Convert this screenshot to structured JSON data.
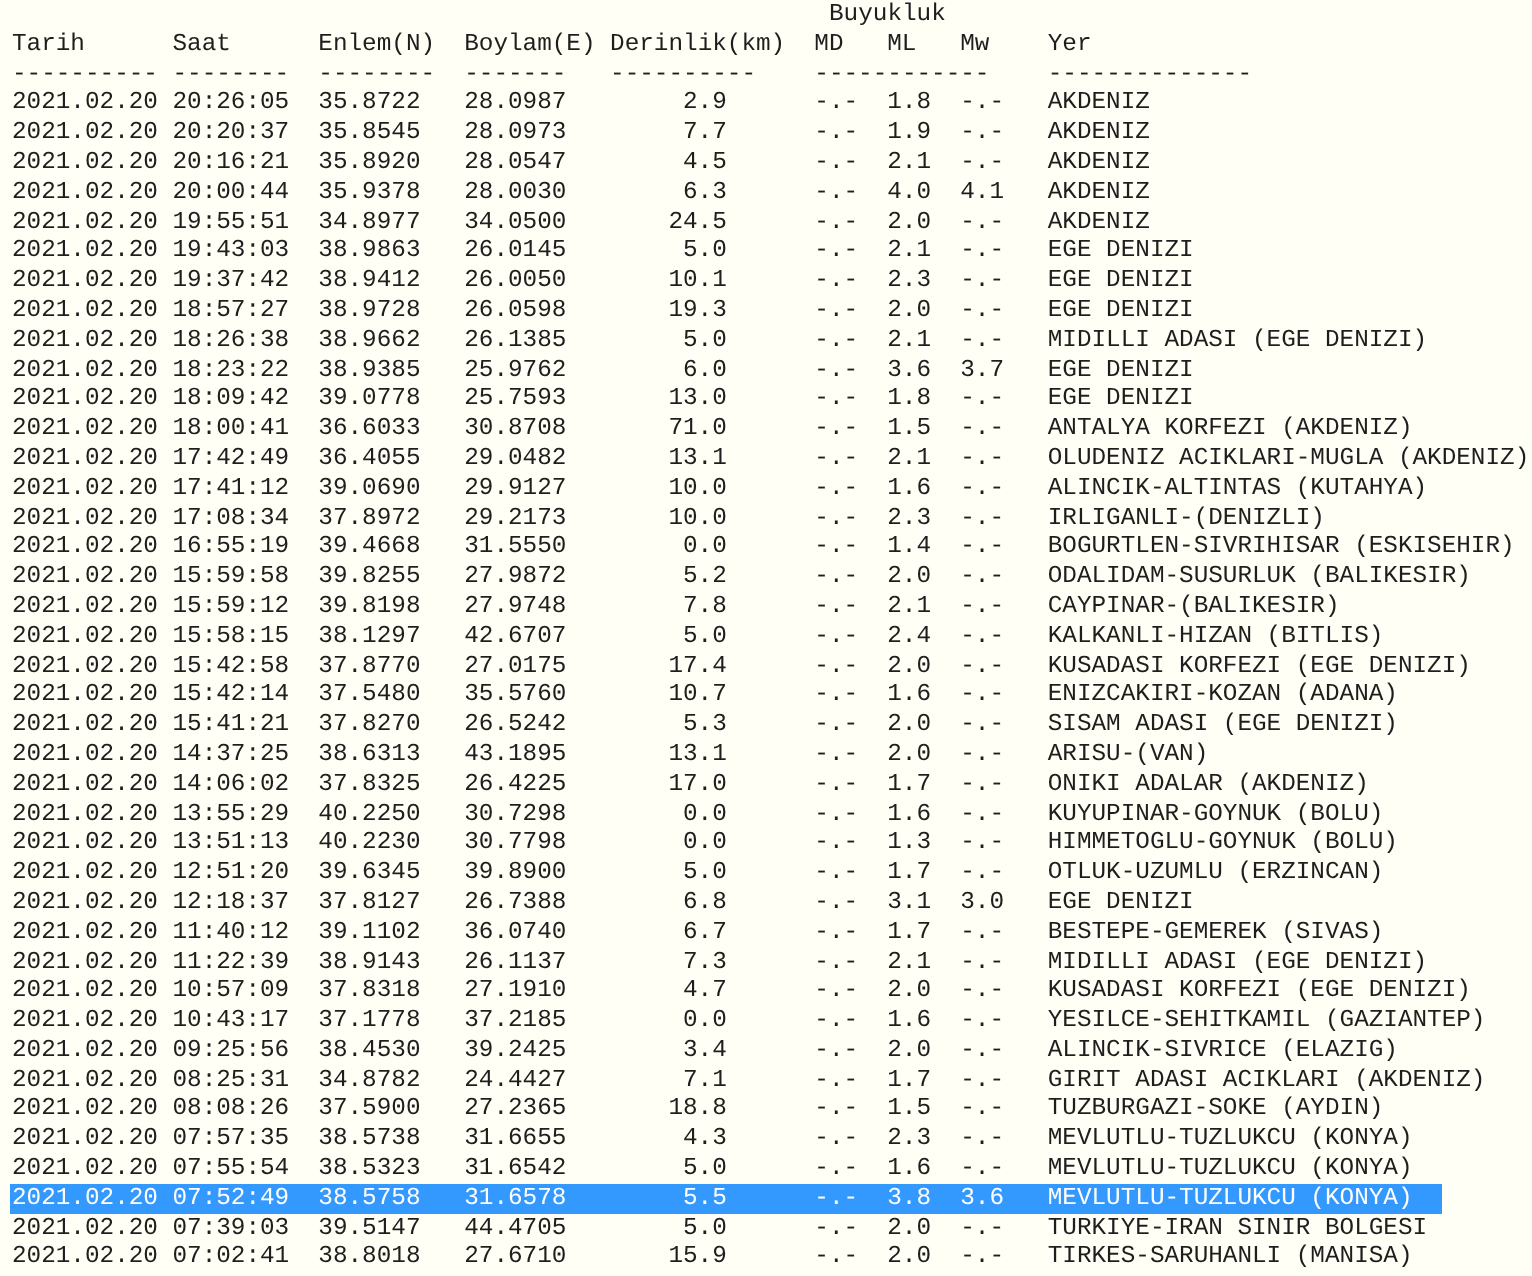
{
  "group_header": "Buyukluk",
  "columns": [
    "Tarih",
    "Saat",
    "Enlem(N)",
    "Boylam(E)",
    "Derinlik(km)",
    "MD",
    "ML",
    "Mw",
    "Yer"
  ],
  "separators": [
    "----------",
    "--------",
    "--------",
    "-------",
    "----------",
    "------------",
    "--------------"
  ],
  "rows": [
    {
      "date": "2021.02.20",
      "time": "20:26:05",
      "lat": "35.8722",
      "lon": "28.0987",
      "depth": "2.9",
      "md": "-.-",
      "ml": "1.8",
      "mw": "-.-",
      "place": "AKDENIZ",
      "selected": false
    },
    {
      "date": "2021.02.20",
      "time": "20:20:37",
      "lat": "35.8545",
      "lon": "28.0973",
      "depth": "7.7",
      "md": "-.-",
      "ml": "1.9",
      "mw": "-.-",
      "place": "AKDENIZ",
      "selected": false
    },
    {
      "date": "2021.02.20",
      "time": "20:16:21",
      "lat": "35.8920",
      "lon": "28.0547",
      "depth": "4.5",
      "md": "-.-",
      "ml": "2.1",
      "mw": "-.-",
      "place": "AKDENIZ",
      "selected": false
    },
    {
      "date": "2021.02.20",
      "time": "20:00:44",
      "lat": "35.9378",
      "lon": "28.0030",
      "depth": "6.3",
      "md": "-.-",
      "ml": "4.0",
      "mw": "4.1",
      "place": "AKDENIZ",
      "selected": false
    },
    {
      "date": "2021.02.20",
      "time": "19:55:51",
      "lat": "34.8977",
      "lon": "34.0500",
      "depth": "24.5",
      "md": "-.-",
      "ml": "2.0",
      "mw": "-.-",
      "place": "AKDENIZ",
      "selected": false
    },
    {
      "date": "2021.02.20",
      "time": "19:43:03",
      "lat": "38.9863",
      "lon": "26.0145",
      "depth": "5.0",
      "md": "-.-",
      "ml": "2.1",
      "mw": "-.-",
      "place": "EGE DENIZI",
      "selected": false
    },
    {
      "date": "2021.02.20",
      "time": "19:37:42",
      "lat": "38.9412",
      "lon": "26.0050",
      "depth": "10.1",
      "md": "-.-",
      "ml": "2.3",
      "mw": "-.-",
      "place": "EGE DENIZI",
      "selected": false
    },
    {
      "date": "2021.02.20",
      "time": "18:57:27",
      "lat": "38.9728",
      "lon": "26.0598",
      "depth": "19.3",
      "md": "-.-",
      "ml": "2.0",
      "mw": "-.-",
      "place": "EGE DENIZI",
      "selected": false
    },
    {
      "date": "2021.02.20",
      "time": "18:26:38",
      "lat": "38.9662",
      "lon": "26.1385",
      "depth": "5.0",
      "md": "-.-",
      "ml": "2.1",
      "mw": "-.-",
      "place": "MIDILLI ADASI (EGE DENIZI)",
      "selected": false
    },
    {
      "date": "2021.02.20",
      "time": "18:23:22",
      "lat": "38.9385",
      "lon": "25.9762",
      "depth": "6.0",
      "md": "-.-",
      "ml": "3.6",
      "mw": "3.7",
      "place": "EGE DENIZI",
      "selected": false
    },
    {
      "date": "2021.02.20",
      "time": "18:09:42",
      "lat": "39.0778",
      "lon": "25.7593",
      "depth": "13.0",
      "md": "-.-",
      "ml": "1.8",
      "mw": "-.-",
      "place": "EGE DENIZI",
      "selected": false
    },
    {
      "date": "2021.02.20",
      "time": "18:00:41",
      "lat": "36.6033",
      "lon": "30.8708",
      "depth": "71.0",
      "md": "-.-",
      "ml": "1.5",
      "mw": "-.-",
      "place": "ANTALYA KORFEZI (AKDENIZ)",
      "selected": false
    },
    {
      "date": "2021.02.20",
      "time": "17:42:49",
      "lat": "36.4055",
      "lon": "29.0482",
      "depth": "13.1",
      "md": "-.-",
      "ml": "2.1",
      "mw": "-.-",
      "place": "OLUDENIZ ACIKLARI-MUGLA (AKDENIZ)",
      "selected": false
    },
    {
      "date": "2021.02.20",
      "time": "17:41:12",
      "lat": "39.0690",
      "lon": "29.9127",
      "depth": "10.0",
      "md": "-.-",
      "ml": "1.6",
      "mw": "-.-",
      "place": "ALINCIK-ALTINTAS (KUTAHYA)",
      "selected": false
    },
    {
      "date": "2021.02.20",
      "time": "17:08:34",
      "lat": "37.8972",
      "lon": "29.2173",
      "depth": "10.0",
      "md": "-.-",
      "ml": "2.3",
      "mw": "-.-",
      "place": "IRLIGANLI-(DENIZLI)",
      "selected": false
    },
    {
      "date": "2021.02.20",
      "time": "16:55:19",
      "lat": "39.4668",
      "lon": "31.5550",
      "depth": "0.0",
      "md": "-.-",
      "ml": "1.4",
      "mw": "-.-",
      "place": "BOGURTLEN-SIVRIHISAR (ESKISEHIR)",
      "selected": false
    },
    {
      "date": "2021.02.20",
      "time": "15:59:58",
      "lat": "39.8255",
      "lon": "27.9872",
      "depth": "5.2",
      "md": "-.-",
      "ml": "2.0",
      "mw": "-.-",
      "place": "ODALIDAM-SUSURLUK (BALIKESIR)",
      "selected": false
    },
    {
      "date": "2021.02.20",
      "time": "15:59:12",
      "lat": "39.8198",
      "lon": "27.9748",
      "depth": "7.8",
      "md": "-.-",
      "ml": "2.1",
      "mw": "-.-",
      "place": "CAYPINAR-(BALIKESIR)",
      "selected": false
    },
    {
      "date": "2021.02.20",
      "time": "15:58:15",
      "lat": "38.1297",
      "lon": "42.6707",
      "depth": "5.0",
      "md": "-.-",
      "ml": "2.4",
      "mw": "-.-",
      "place": "KALKANLI-HIZAN (BITLIS)",
      "selected": false
    },
    {
      "date": "2021.02.20",
      "time": "15:42:58",
      "lat": "37.8770",
      "lon": "27.0175",
      "depth": "17.4",
      "md": "-.-",
      "ml": "2.0",
      "mw": "-.-",
      "place": "KUSADASI KORFEZI (EGE DENIZI)",
      "selected": false
    },
    {
      "date": "2021.02.20",
      "time": "15:42:14",
      "lat": "37.5480",
      "lon": "35.5760",
      "depth": "10.7",
      "md": "-.-",
      "ml": "1.6",
      "mw": "-.-",
      "place": "ENIZCAKIRI-KOZAN (ADANA)",
      "selected": false
    },
    {
      "date": "2021.02.20",
      "time": "15:41:21",
      "lat": "37.8270",
      "lon": "26.5242",
      "depth": "5.3",
      "md": "-.-",
      "ml": "2.0",
      "mw": "-.-",
      "place": "SISAM ADASI (EGE DENIZI)",
      "selected": false
    },
    {
      "date": "2021.02.20",
      "time": "14:37:25",
      "lat": "38.6313",
      "lon": "43.1895",
      "depth": "13.1",
      "md": "-.-",
      "ml": "2.0",
      "mw": "-.-",
      "place": "ARISU-(VAN)",
      "selected": false
    },
    {
      "date": "2021.02.20",
      "time": "14:06:02",
      "lat": "37.8325",
      "lon": "26.4225",
      "depth": "17.0",
      "md": "-.-",
      "ml": "1.7",
      "mw": "-.-",
      "place": "ONIKI ADALAR (AKDENIZ)",
      "selected": false
    },
    {
      "date": "2021.02.20",
      "time": "13:55:29",
      "lat": "40.2250",
      "lon": "30.7298",
      "depth": "0.0",
      "md": "-.-",
      "ml": "1.6",
      "mw": "-.-",
      "place": "KUYUPINAR-GOYNUK (BOLU)",
      "selected": false
    },
    {
      "date": "2021.02.20",
      "time": "13:51:13",
      "lat": "40.2230",
      "lon": "30.7798",
      "depth": "0.0",
      "md": "-.-",
      "ml": "1.3",
      "mw": "-.-",
      "place": "HIMMETOGLU-GOYNUK (BOLU)",
      "selected": false
    },
    {
      "date": "2021.02.20",
      "time": "12:51:20",
      "lat": "39.6345",
      "lon": "39.8900",
      "depth": "5.0",
      "md": "-.-",
      "ml": "1.7",
      "mw": "-.-",
      "place": "OTLUK-UZUMLU (ERZINCAN)",
      "selected": false
    },
    {
      "date": "2021.02.20",
      "time": "12:18:37",
      "lat": "37.8127",
      "lon": "26.7388",
      "depth": "6.8",
      "md": "-.-",
      "ml": "3.1",
      "mw": "3.0",
      "place": "EGE DENIZI",
      "selected": false
    },
    {
      "date": "2021.02.20",
      "time": "11:40:12",
      "lat": "39.1102",
      "lon": "36.0740",
      "depth": "6.7",
      "md": "-.-",
      "ml": "1.7",
      "mw": "-.-",
      "place": "BESTEPE-GEMEREK (SIVAS)",
      "selected": false
    },
    {
      "date": "2021.02.20",
      "time": "11:22:39",
      "lat": "38.9143",
      "lon": "26.1137",
      "depth": "7.3",
      "md": "-.-",
      "ml": "2.1",
      "mw": "-.-",
      "place": "MIDILLI ADASI (EGE DENIZI)",
      "selected": false
    },
    {
      "date": "2021.02.20",
      "time": "10:57:09",
      "lat": "37.8318",
      "lon": "27.1910",
      "depth": "4.7",
      "md": "-.-",
      "ml": "2.0",
      "mw": "-.-",
      "place": "KUSADASI KORFEZI (EGE DENIZI)",
      "selected": false
    },
    {
      "date": "2021.02.20",
      "time": "10:43:17",
      "lat": "37.1778",
      "lon": "37.2185",
      "depth": "0.0",
      "md": "-.-",
      "ml": "1.6",
      "mw": "-.-",
      "place": "YESILCE-SEHITKAMIL (GAZIANTEP)",
      "selected": false
    },
    {
      "date": "2021.02.20",
      "time": "09:25:56",
      "lat": "38.4530",
      "lon": "39.2425",
      "depth": "3.4",
      "md": "-.-",
      "ml": "2.0",
      "mw": "-.-",
      "place": "ALINCIK-SIVRICE (ELAZIG)",
      "selected": false
    },
    {
      "date": "2021.02.20",
      "time": "08:25:31",
      "lat": "34.8782",
      "lon": "24.4427",
      "depth": "7.1",
      "md": "-.-",
      "ml": "1.7",
      "mw": "-.-",
      "place": "GIRIT ADASI ACIKLARI (AKDENIZ)",
      "selected": false
    },
    {
      "date": "2021.02.20",
      "time": "08:08:26",
      "lat": "37.5900",
      "lon": "27.2365",
      "depth": "18.8",
      "md": "-.-",
      "ml": "1.5",
      "mw": "-.-",
      "place": "TUZBURGAZI-SOKE (AYDIN)",
      "selected": false
    },
    {
      "date": "2021.02.20",
      "time": "07:57:35",
      "lat": "38.5738",
      "lon": "31.6655",
      "depth": "4.3",
      "md": "-.-",
      "ml": "2.3",
      "mw": "-.-",
      "place": "MEVLUTLU-TUZLUKCU (KONYA)",
      "selected": false
    },
    {
      "date": "2021.02.20",
      "time": "07:55:54",
      "lat": "38.5323",
      "lon": "31.6542",
      "depth": "5.0",
      "md": "-.-",
      "ml": "1.6",
      "mw": "-.-",
      "place": "MEVLUTLU-TUZLUKCU (KONYA)",
      "selected": false
    },
    {
      "date": "2021.02.20",
      "time": "07:52:49",
      "lat": "38.5758",
      "lon": "31.6578",
      "depth": "5.5",
      "md": "-.-",
      "ml": "3.8",
      "mw": "3.6",
      "place": "MEVLUTLU-TUZLUKCU (KONYA)",
      "selected": true
    },
    {
      "date": "2021.02.20",
      "time": "07:39:03",
      "lat": "39.5147",
      "lon": "44.4705",
      "depth": "5.0",
      "md": "-.-",
      "ml": "2.0",
      "mw": "-.-",
      "place": "TURKIYE-IRAN SINIR BOLGESI",
      "selected": false
    },
    {
      "date": "2021.02.20",
      "time": "07:02:41",
      "lat": "38.8018",
      "lon": "27.6710",
      "depth": "15.9",
      "md": "-.-",
      "ml": "2.0",
      "mw": "-.-",
      "place": "TIRKES-SARUHANLI (MANISA)",
      "selected": false
    }
  ]
}
